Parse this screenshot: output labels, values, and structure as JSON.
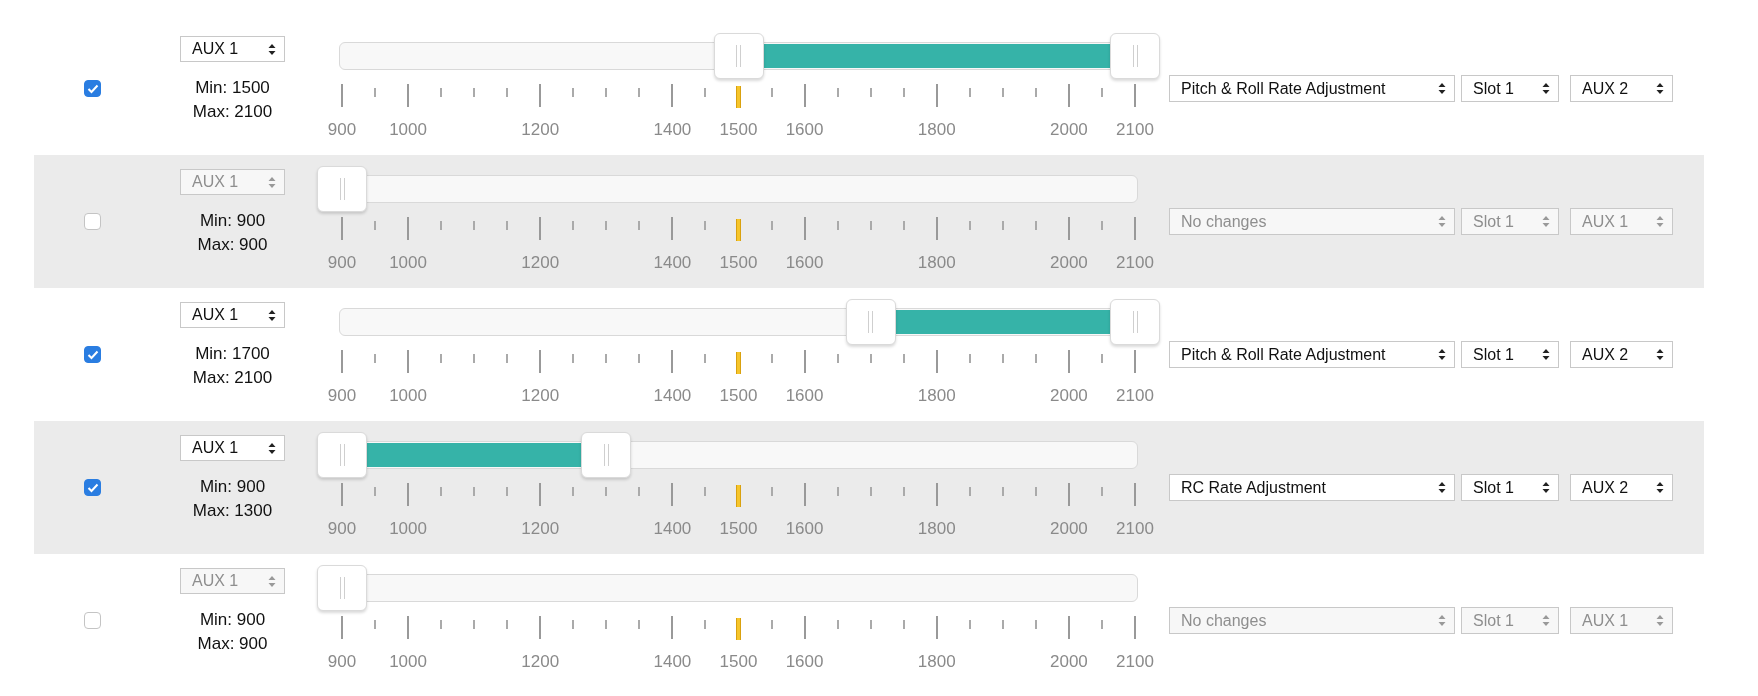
{
  "rows": [
    {
      "enabled": true,
      "channel": "AUX 1",
      "min_text": "Min: 1500",
      "max_text": "Max: 2100",
      "scale": [
        "900",
        "1000",
        "1200",
        "1400",
        "1500",
        "1600",
        "1800",
        "2000",
        "2100"
      ],
      "function": "Pitch & Roll Rate Adjustment",
      "slot": "Slot 1",
      "switch": "AUX 2"
    },
    {
      "enabled": false,
      "channel": "AUX 1",
      "min_text": "Min: 900",
      "max_text": "Max: 900",
      "scale": [
        "900",
        "1000",
        "1200",
        "1400",
        "1500",
        "1600",
        "1800",
        "2000",
        "2100"
      ],
      "function": "No changes",
      "slot": "Slot 1",
      "switch": "AUX 1"
    },
    {
      "enabled": true,
      "channel": "AUX 1",
      "min_text": "Min: 1700",
      "max_text": "Max: 2100",
      "scale": [
        "900",
        "1000",
        "1200",
        "1400",
        "1500",
        "1600",
        "1800",
        "2000",
        "2100"
      ],
      "function": "Pitch & Roll Rate Adjustment",
      "slot": "Slot 1",
      "switch": "AUX 2"
    },
    {
      "enabled": true,
      "channel": "AUX 1",
      "min_text": "Min: 900",
      "max_text": "Max: 1300",
      "scale": [
        "900",
        "1000",
        "1200",
        "1400",
        "1500",
        "1600",
        "1800",
        "2000",
        "2100"
      ],
      "function": "RC Rate Adjustment",
      "slot": "Slot 1",
      "switch": "AUX 2"
    },
    {
      "enabled": false,
      "channel": "AUX 1",
      "min_text": "Min: 900",
      "max_text": "Max: 900",
      "scale": [
        "900",
        "1000",
        "1200",
        "1400",
        "1500",
        "1600",
        "1800",
        "2000",
        "2100"
      ],
      "function": "No changes",
      "slot": "Slot 1",
      "switch": "AUX 1"
    }
  ]
}
